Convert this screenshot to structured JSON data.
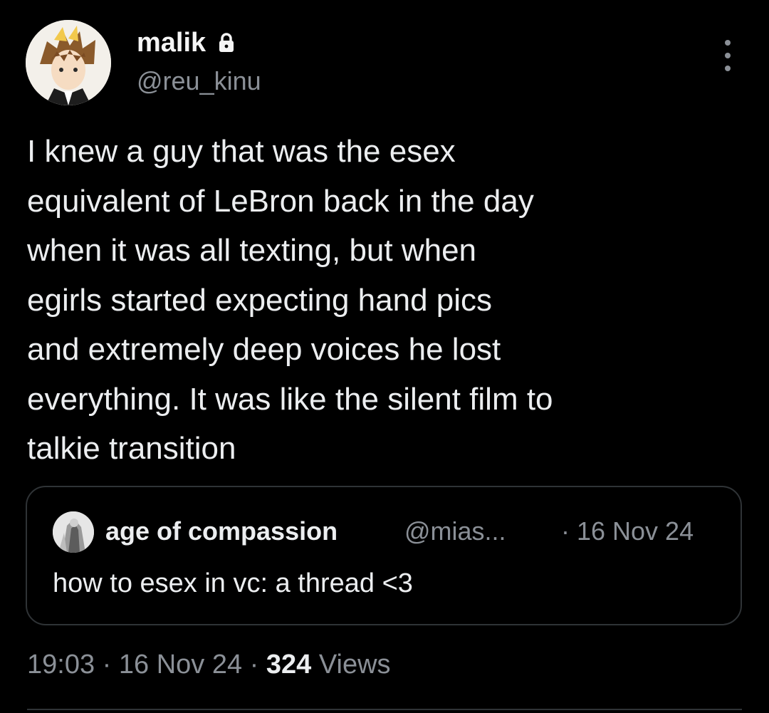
{
  "author": {
    "display_name": "malik",
    "handle": "@reu_kinu",
    "avatar_icon": "anime-character-avatar",
    "protected_icon": "lock-icon"
  },
  "menu_icon": "more-options-icon",
  "tweet": {
    "lines": [
      "I knew a guy that was the esex",
      "equivalent of LeBron back in the day",
      "when it was all texting, but when",
      "egirls started expecting hand pics",
      "and extremely deep voices he lost",
      "everything. It was like the silent film to",
      "talkie transition"
    ]
  },
  "quote": {
    "display_name": "age of compassion",
    "handle": "@mias...",
    "date": "· 16 Nov 24",
    "text": "how to esex in vc: a thread <3",
    "avatar_icon": "grayscale-figure-avatar"
  },
  "meta": {
    "time": "19:03",
    "separator": " · ",
    "date": "16 Nov 24",
    "views_count": "324",
    "views_label": "Views"
  },
  "colors": {
    "background": "#000000",
    "primary_text": "#e7e9ea",
    "secondary_text": "#8b9097",
    "border": "#2f3336"
  }
}
